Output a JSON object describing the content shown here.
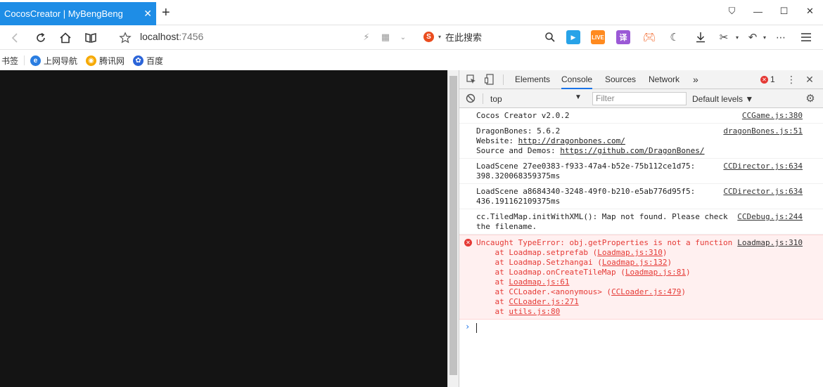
{
  "tab": {
    "title": "CocosCreator | MyBengBeng",
    "close": "✕"
  },
  "newtab": "+",
  "window": {
    "pin": "⛉",
    "minimize": "—",
    "maximize": "☐",
    "close": "✕"
  },
  "address": {
    "host": "localhost",
    "port": ":7456"
  },
  "search": {
    "engine_icon": "S",
    "text": "在此搜索"
  },
  "toolbar": {
    "live": "LIVE",
    "translate": "译"
  },
  "bookmarks": {
    "label": "书签",
    "items": [
      {
        "label": "上网导航",
        "icon": "e",
        "color": "#2a7de1"
      },
      {
        "label": "腾讯网",
        "icon": "◉",
        "color": "#f6a900"
      },
      {
        "label": "百度",
        "icon": "✿",
        "color": "#2b64d8"
      }
    ]
  },
  "devtools": {
    "tabs": [
      "Elements",
      "Console",
      "Sources",
      "Network"
    ],
    "more": "»",
    "error_count": "1",
    "context": "top",
    "filter_placeholder": "Filter",
    "levels": "Default levels ▼",
    "messages": [
      {
        "lines": [
          "Cocos Creator v2.0.2"
        ],
        "source": "CCGame.js:380"
      },
      {
        "lines": [
          "DragonBones: 5.6.2"
        ],
        "website_label": "Website: ",
        "website": "http://dragonbones.com/",
        "demos_label": "Source and Demos: ",
        "demos": "https://github.com/DragonBones/",
        "source": "dragonBones.js:51"
      },
      {
        "lines": [
          "LoadScene 27ee0383-f933-47a4-b52e-75b112ce1d75:",
          "398.320068359375ms"
        ],
        "source": "CCDirector.js:634"
      },
      {
        "lines": [
          "LoadScene a8684340-3248-49f0-b210-e5ab776d95f5:",
          "436.191162109375ms"
        ],
        "source": "CCDirector.js:634"
      },
      {
        "lines": [
          "cc.TiledMap.initWithXML(): Map not found. Please check",
          "the filename."
        ],
        "source": "CCDebug.js:244"
      }
    ],
    "error": {
      "message": "Uncaught TypeError: obj.getProperties is not a function",
      "source": "Loadmap.js:310",
      "stack": [
        {
          "at": "Loadmap.setprefab",
          "loc": "Loadmap.js:310"
        },
        {
          "at": "Loadmap.Setzhangai",
          "loc": "Loadmap.js:132"
        },
        {
          "at": "Loadmap.onCreateTileMap",
          "loc": "Loadmap.js:81"
        },
        {
          "at": "",
          "loc": "Loadmap.js:61"
        },
        {
          "at": "CCLoader.<anonymous>",
          "loc": "CCLoader.js:479"
        },
        {
          "at": "",
          "loc": "CCLoader.js:271"
        },
        {
          "at": "",
          "loc": "utils.js:80"
        }
      ]
    },
    "prompt": "›"
  }
}
